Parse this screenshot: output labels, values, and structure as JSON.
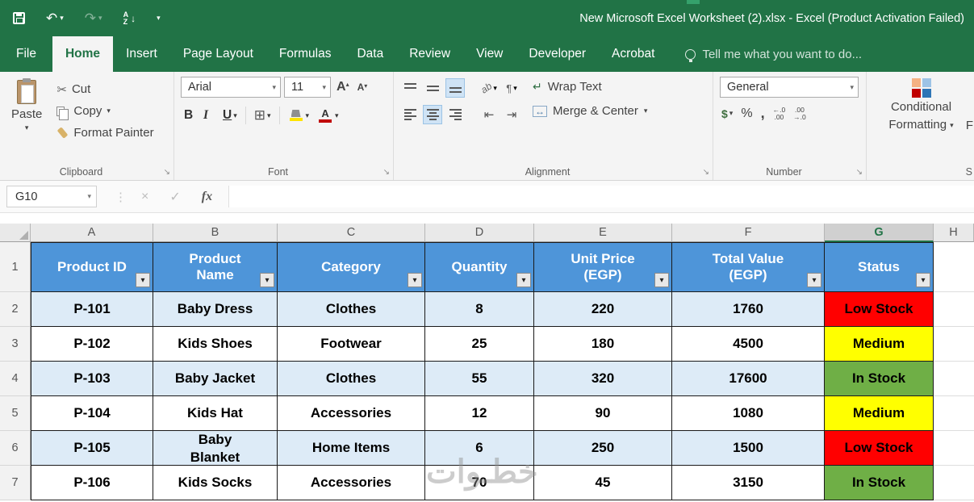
{
  "colors": {
    "accent_green": "#217346",
    "header_blue": "#4E95D9",
    "band_blue": "#DDEBF7",
    "fill_swatch": "#FFE400",
    "font_color_swatch": "#C00000"
  },
  "icons": {
    "dropdown": "▾",
    "up": "▴",
    "launcher": "↘",
    "separator": "⋮"
  },
  "window": {
    "title": "New Microsoft Excel Worksheet (2).xlsx - Excel (Product Activation Failed)"
  },
  "qat": {
    "undo": "↶",
    "redo": "↷",
    "sort_a": "A",
    "sort_z": "Z",
    "sort_arrow": "↓"
  },
  "tabs": {
    "items": [
      "File",
      "Home",
      "Insert",
      "Page Layout",
      "Formulas",
      "Data",
      "Review",
      "View",
      "Developer",
      "Acrobat"
    ],
    "active": "Home",
    "tell_me": "Tell me what you want to do..."
  },
  "ribbon": {
    "clipboard": {
      "label": "Clipboard",
      "paste": "Paste",
      "cut": "Cut",
      "copy": "Copy",
      "format_painter": "Format Painter"
    },
    "font": {
      "label": "Font",
      "family": "Arial",
      "size": "11",
      "bold": "B",
      "italic": "I",
      "underline": "U",
      "grow": "A",
      "shrink": "A",
      "borders": "⊞",
      "color_letter": "A"
    },
    "alignment": {
      "label": "Alignment",
      "wrap_text": "Wrap Text",
      "merge_center": "Merge & Center",
      "orientation": "ab",
      "pilcrow": "¶",
      "wrap_icon": "↵",
      "merge_icon": "↔",
      "outdent": "⇤",
      "indent": "⇥"
    },
    "number": {
      "label": "Number",
      "format": "General",
      "currency": "$",
      "percent": "%",
      "comma": ",",
      "inc_top": "←.0",
      "inc_bottom": ".00",
      "dec_top": ".00",
      "dec_bottom": "→.0"
    },
    "styles": {
      "cf_line1": "Conditional",
      "cf_line2": "Formatting",
      "clipped_button": "F",
      "clipped_label": "S"
    }
  },
  "formula_bar": {
    "name_box": "G10",
    "cancel": "×",
    "enter": "✓",
    "fx": "fx",
    "formula": ""
  },
  "sheet": {
    "columns": [
      "A",
      "B",
      "C",
      "D",
      "E",
      "F",
      "G",
      "H"
    ],
    "active_column": "G",
    "rows": [
      "1",
      "2",
      "3",
      "4",
      "5",
      "6",
      "7"
    ],
    "headers": [
      "Product ID",
      "Product Name",
      "Category",
      "Quantity",
      "Unit Price (EGP)",
      "Total Value (EGP)",
      "Status"
    ],
    "filter_icon": "▾",
    "data": [
      {
        "product_id": "P-101",
        "product_name": "Baby Dress",
        "category": "Clothes",
        "quantity": "8",
        "unit_price": "220",
        "total_value": "1760",
        "status": "Low Stock",
        "status_bg": "#FF0000"
      },
      {
        "product_id": "P-102",
        "product_name": "Kids Shoes",
        "category": "Footwear",
        "quantity": "25",
        "unit_price": "180",
        "total_value": "4500",
        "status": "Medium",
        "status_bg": "#FFFF00"
      },
      {
        "product_id": "P-103",
        "product_name": "Baby Jacket",
        "category": "Clothes",
        "quantity": "55",
        "unit_price": "320",
        "total_value": "17600",
        "status": "In Stock",
        "status_bg": "#6FAF46"
      },
      {
        "product_id": "P-104",
        "product_name": "Kids Hat",
        "category": "Accessories",
        "quantity": "12",
        "unit_price": "90",
        "total_value": "1080",
        "status": "Medium",
        "status_bg": "#FFFF00"
      },
      {
        "product_id": "P-105",
        "product_name": "Baby Blanket",
        "category": "Home Items",
        "quantity": "6",
        "unit_price": "250",
        "total_value": "1500",
        "status": "Low Stock",
        "status_bg": "#FF0000"
      },
      {
        "product_id": "P-106",
        "product_name": "Kids Socks",
        "category": "Accessories",
        "quantity": "70",
        "unit_price": "45",
        "total_value": "3150",
        "status": "In Stock",
        "status_bg": "#6FAF46"
      }
    ],
    "watermark": "خطـوات"
  }
}
